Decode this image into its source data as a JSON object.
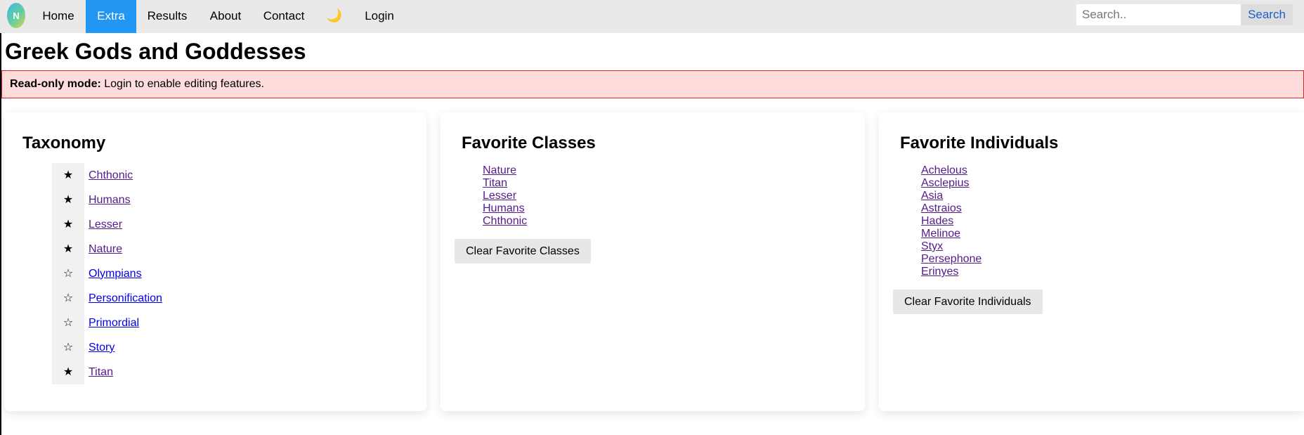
{
  "nav": {
    "logo_text": "N",
    "items": [
      {
        "label": "Home",
        "active": false
      },
      {
        "label": "Extra",
        "active": true
      },
      {
        "label": "Results",
        "active": false
      },
      {
        "label": "About",
        "active": false
      },
      {
        "label": "Contact",
        "active": false
      }
    ],
    "theme_toggle": "🌙",
    "login": "Login",
    "search_placeholder": "Search..",
    "search_button": "Search"
  },
  "page_title": "Greek Gods and Goddesses",
  "alert": {
    "bold": "Read-only mode:",
    "text": " Login to enable editing features."
  },
  "taxonomy": {
    "title": "Taxonomy",
    "items": [
      {
        "star": "★",
        "label": "Chthonic"
      },
      {
        "star": "★",
        "label": "Humans"
      },
      {
        "star": "★",
        "label": "Lesser"
      },
      {
        "star": "★",
        "label": "Nature"
      },
      {
        "star": "☆",
        "label": "Olympians"
      },
      {
        "star": "☆",
        "label": "Personification"
      },
      {
        "star": "☆",
        "label": "Primordial"
      },
      {
        "star": "☆",
        "label": "Story"
      },
      {
        "star": "★",
        "label": "Titan"
      }
    ]
  },
  "favorite_classes": {
    "title": "Favorite Classes",
    "items": [
      "Nature",
      "Titan",
      "Lesser",
      "Humans",
      "Chthonic"
    ],
    "clear_button": "Clear Favorite Classes"
  },
  "favorite_individuals": {
    "title": "Favorite Individuals",
    "items": [
      "Achelous",
      "Asclepius",
      "Asia",
      "Astraios",
      "Hades",
      "Melinoe",
      "Styx",
      "Persephone",
      "Erinyes"
    ],
    "clear_button": "Clear Favorite Individuals"
  },
  "colors": {
    "nav_bg": "#e9e9e9",
    "active_tab": "#2196F3",
    "alert_bg": "#ffdddd",
    "alert_border": "#d42a2a",
    "visited_link": "#551a8b",
    "link": "#0000ee"
  }
}
